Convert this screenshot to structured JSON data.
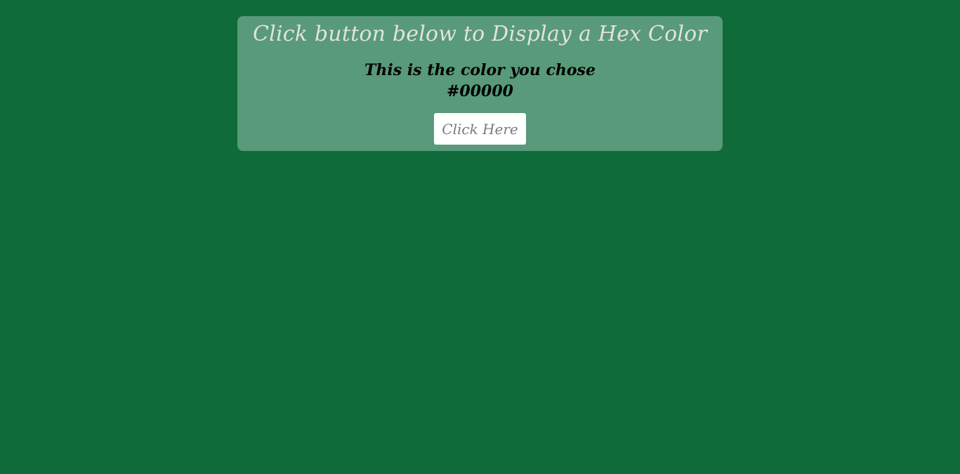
{
  "colors": {
    "background": "#106b3a",
    "card": "#589a79",
    "title_text": "#e2e2dd",
    "button_bg": "#ffffff",
    "button_text": "#7a7a7a"
  },
  "card": {
    "title": "Click button below to Display a Hex Color",
    "subtitle": "This is the color you chose",
    "hex_value": "#00000"
  },
  "button": {
    "label": "Click Here"
  }
}
